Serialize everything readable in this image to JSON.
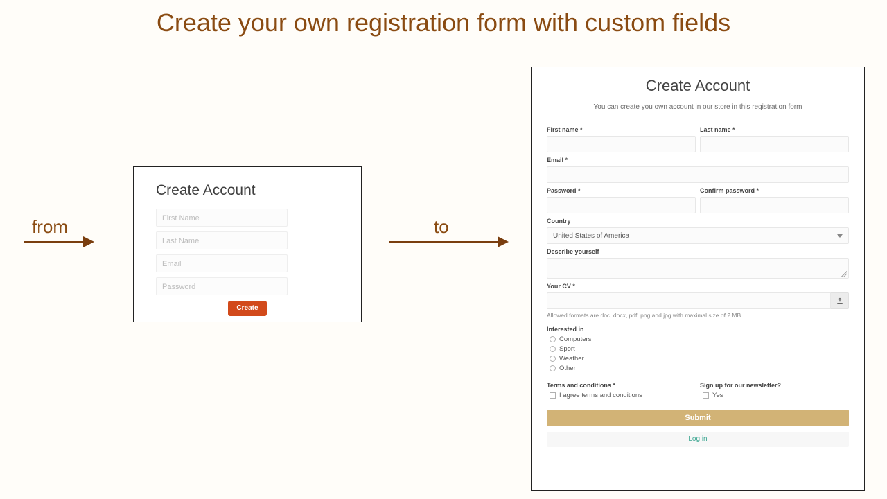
{
  "headline": "Create your own registration form with custom fields",
  "arrows": {
    "from": "from",
    "to": "to"
  },
  "simple": {
    "title": "Create Account",
    "fields": {
      "first_name": "First Name",
      "last_name": "Last Name",
      "email": "Email",
      "password": "Password"
    },
    "submit": "Create"
  },
  "rich": {
    "title": "Create Account",
    "subtitle": "You can create you own account in our store in this registration form",
    "labels": {
      "first_name": "First name *",
      "last_name": "Last name *",
      "email": "Email *",
      "password": "Password *",
      "confirm_password": "Confirm password *",
      "country": "Country",
      "describe": "Describe yourself",
      "cv": "Your CV *",
      "interested": "Interested in",
      "terms": "Terms and conditions *",
      "newsletter": "Sign up for our newsletter?"
    },
    "country_value": "United States of America",
    "cv_hint": "Allowed formats are doc, docx, pdf, png and jpg with maximal size of 2 MB",
    "interests": [
      "Computers",
      "Sport",
      "Weather",
      "Other"
    ],
    "terms_check": "I agree terms and conditions",
    "newsletter_check": "Yes",
    "submit": "Submit",
    "login": "Log in"
  }
}
